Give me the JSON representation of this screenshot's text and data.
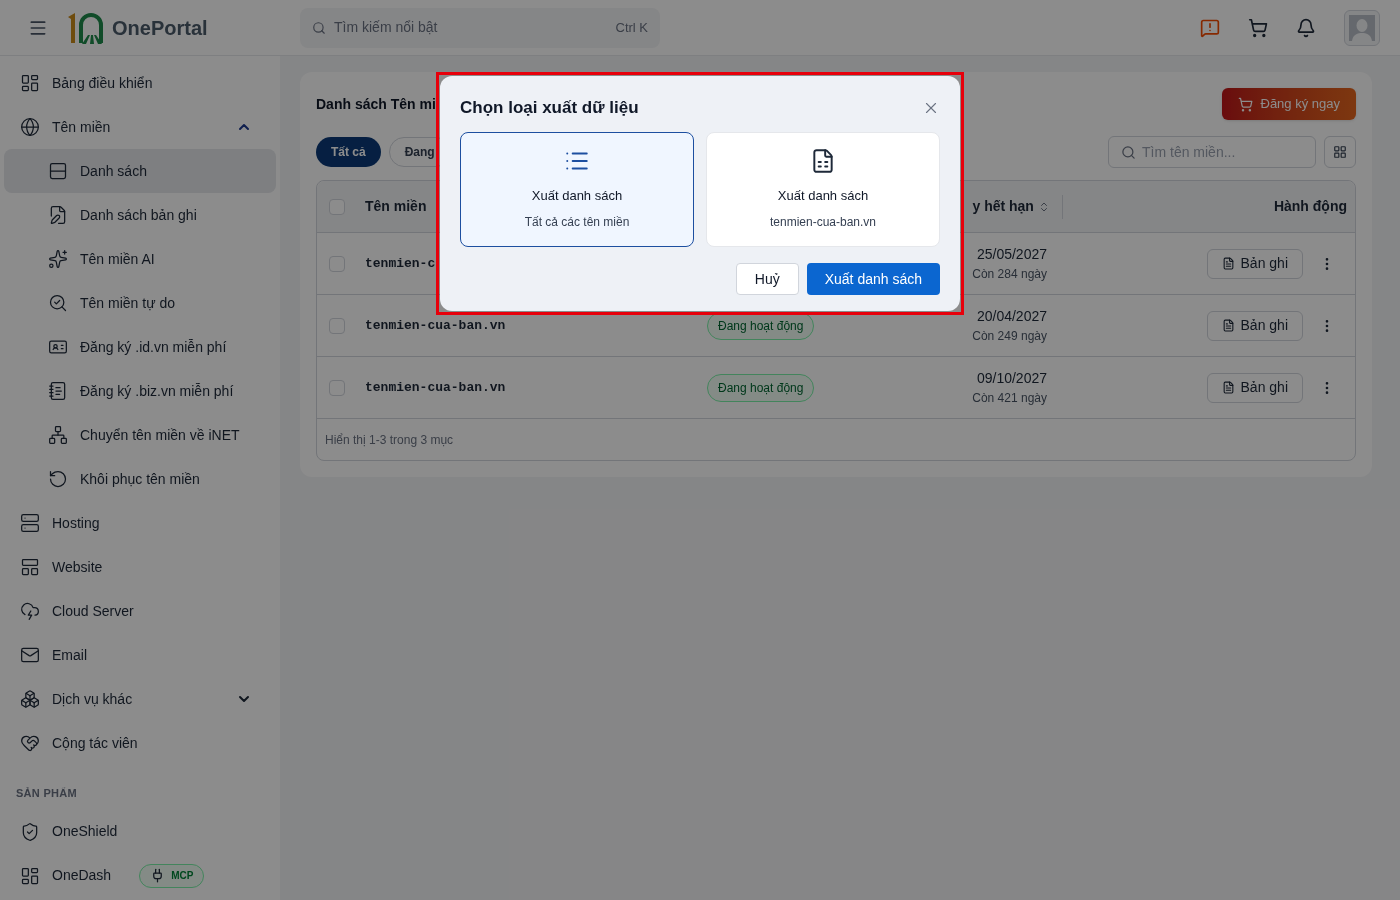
{
  "header": {
    "brand": "OnePortal",
    "search": {
      "placeholder": "Tìm kiếm nổi bật",
      "shortcut": [
        "Ctrl",
        "K"
      ]
    }
  },
  "sidebar": {
    "items": [
      {
        "kind": "link",
        "label": "Bảng điều khiển",
        "selected": false
      },
      {
        "kind": "group",
        "label": "Tên miền",
        "selected": false,
        "expanded": true,
        "children": [
          {
            "label": "Danh sách",
            "selected": true
          },
          {
            "label": "Danh sách bản ghi",
            "selected": false
          },
          {
            "label": "Tên miền AI",
            "selected": false
          },
          {
            "label": "Tên miền tự do",
            "selected": false
          },
          {
            "label": "Đăng ký .id.vn miễn phí",
            "selected": false
          },
          {
            "label": "Đăng ký .biz.vn miễn phí",
            "selected": false
          },
          {
            "label": "Chuyển tên miền về iNET",
            "selected": false
          },
          {
            "label": "Khôi phục tên miền",
            "selected": false
          }
        ]
      },
      {
        "kind": "link",
        "label": "Hosting",
        "selected": false
      },
      {
        "kind": "link",
        "label": "Website",
        "selected": false
      },
      {
        "kind": "link",
        "label": "Cloud Server",
        "selected": false
      },
      {
        "kind": "link",
        "label": "Email",
        "selected": false
      },
      {
        "kind": "group",
        "label": "Dịch vụ khác",
        "selected": false,
        "expanded": false
      },
      {
        "kind": "link",
        "label": "Cộng tác viên",
        "selected": false
      }
    ],
    "section": {
      "title": "SẢN PHẨM",
      "items": [
        {
          "label": "OneShield",
          "selected": false
        },
        {
          "label": "OneDash",
          "selected": false,
          "badge": "MCP"
        }
      ]
    }
  },
  "card": {
    "title": "Danh sách Tên mi",
    "register_button": "Đăng ký ngay",
    "tabs": [
      {
        "label": "Tất cả",
        "selected": true
      },
      {
        "label": "Đang",
        "selected": false
      }
    ],
    "search": {
      "placeholder": "Tìm tên miền..."
    },
    "table": {
      "select_all_checked": false,
      "columns": [
        "Tên miền",
        "y hết hạn",
        "Hành động"
      ],
      "rows": [
        {
          "checked": false,
          "domain": "tenmien-c",
          "date": "25/05/2027",
          "remaining": "Còn 284 ngày",
          "action": "Bản ghi"
        },
        {
          "checked": false,
          "domain": "tenmien-cua-ban.vn",
          "status": "Đang hoạt động",
          "date": "20/04/2027",
          "remaining": "Còn 249 ngày",
          "action": "Bản ghi"
        },
        {
          "checked": false,
          "domain": "tenmien-cua-ban.vn",
          "status": "Đang hoạt động",
          "date": "09/10/2027",
          "remaining": "Còn 421 ngày",
          "action": "Bản ghi"
        }
      ],
      "footer": "Hiển thị 1-3 trong 3 mục"
    }
  },
  "dialog": {
    "title": "Chọn loại xuất dữ liệu",
    "options": [
      {
        "title": "Xuất danh sách",
        "subtitle": "Tất cả các tên miền",
        "selected": true
      },
      {
        "title": "Xuất danh sách",
        "subtitle": "tenmien-cua-ban.vn",
        "selected": false
      }
    ],
    "buttons": [
      {
        "kind": "secondary",
        "label": "Huỷ"
      },
      {
        "kind": "primary",
        "label": "Xuất danh sách"
      }
    ]
  }
}
